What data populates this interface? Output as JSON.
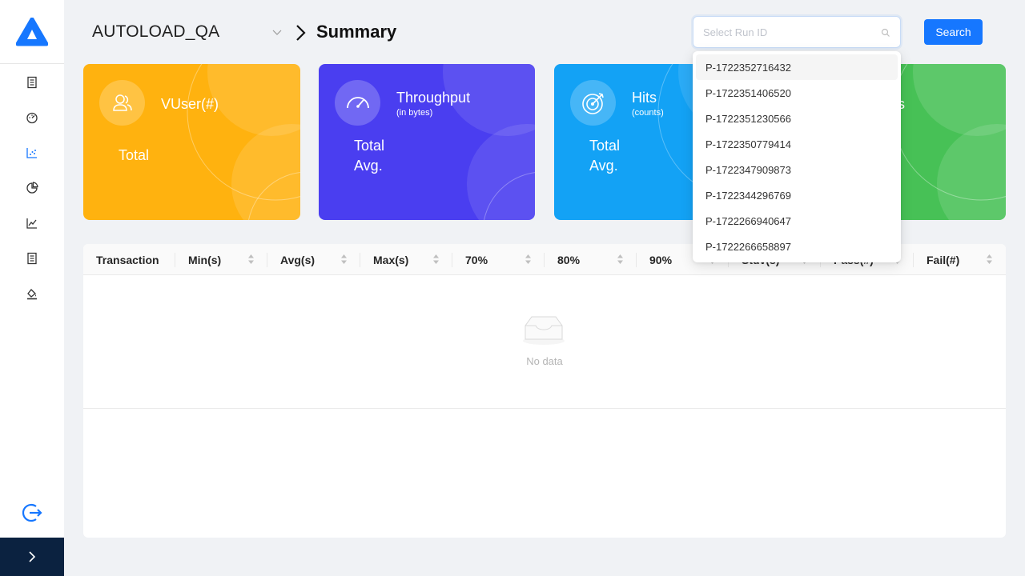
{
  "app": {
    "logo_icon": "delta-logo-icon",
    "accent_color": "#1677ff"
  },
  "sidebar": {
    "items": [
      {
        "icon": "report-doc-icon",
        "active": false
      },
      {
        "icon": "dashboard-gauge-icon",
        "active": false
      },
      {
        "icon": "scatter-chart-icon",
        "active": true
      },
      {
        "icon": "pie-chart-icon",
        "active": false
      },
      {
        "icon": "line-chart-icon",
        "active": false
      },
      {
        "icon": "document-list-icon",
        "active": false
      },
      {
        "icon": "paint-bucket-icon",
        "active": false
      }
    ],
    "logout_icon": "logout-icon",
    "collapse_icon": "chevron-right-icon"
  },
  "header": {
    "project": "AUTOLOAD_QA",
    "page_title": "Summary",
    "run_select_placeholder": "Select Run ID",
    "search_label": "Search"
  },
  "cards": [
    {
      "title": "VUser(#)",
      "subtitle": "",
      "labels": [
        "Total"
      ],
      "color": "#ffb20f",
      "icon": "users-icon"
    },
    {
      "title": "Throughput",
      "subtitle": "(in bytes)",
      "labels": [
        "Total",
        "Avg."
      ],
      "color": "#4a3ef0",
      "icon": "speedometer-icon"
    },
    {
      "title": "Hits",
      "subtitle": "(counts)",
      "labels": [
        "Total",
        "Avg."
      ],
      "color": "#13a2f5",
      "icon": "target-icon"
    },
    {
      "title_partial": "s",
      "color": "#47c156"
    }
  ],
  "table": {
    "columns": [
      "Transaction",
      "Min(s)",
      "Avg(s)",
      "Max(s)",
      "70%",
      "80%",
      "90%",
      "Stdv(s)",
      "Pass(#)",
      "Fail(#)"
    ],
    "empty_text": "No data"
  },
  "dropdown": {
    "options": [
      "P-1722352716432",
      "P-1722351406520",
      "P-1722351230566",
      "P-1722350779414",
      "P-1722347909873",
      "P-1722344296769",
      "P-1722266940647",
      "P-1722266658897"
    ],
    "highlighted_index": 0
  }
}
